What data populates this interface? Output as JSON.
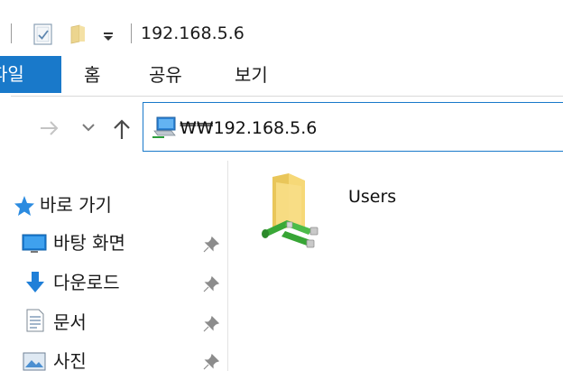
{
  "window": {
    "title": "192.168.5.6"
  },
  "ribbon": {
    "tabs": [
      {
        "label": "파일",
        "active": true
      },
      {
        "label": "홈"
      },
      {
        "label": "공유"
      },
      {
        "label": "보기"
      }
    ]
  },
  "navigation": {
    "address": "₩₩192.168.5.6"
  },
  "sidebar": {
    "quick_access_label": "바로 가기",
    "items": [
      {
        "label": "바탕 화면",
        "icon": "desktop-icon",
        "pinned": true
      },
      {
        "label": "다운로드",
        "icon": "download-icon",
        "pinned": true
      },
      {
        "label": "문서",
        "icon": "document-icon",
        "pinned": true
      },
      {
        "label": "사진",
        "icon": "pictures-icon",
        "pinned": true
      }
    ]
  },
  "content": {
    "items": [
      {
        "name": "Users",
        "icon": "shared-folder-icon"
      }
    ]
  },
  "colors": {
    "accent": "#1979ca",
    "folder": "#f6d26b",
    "share_pipe": "#3aa838"
  }
}
